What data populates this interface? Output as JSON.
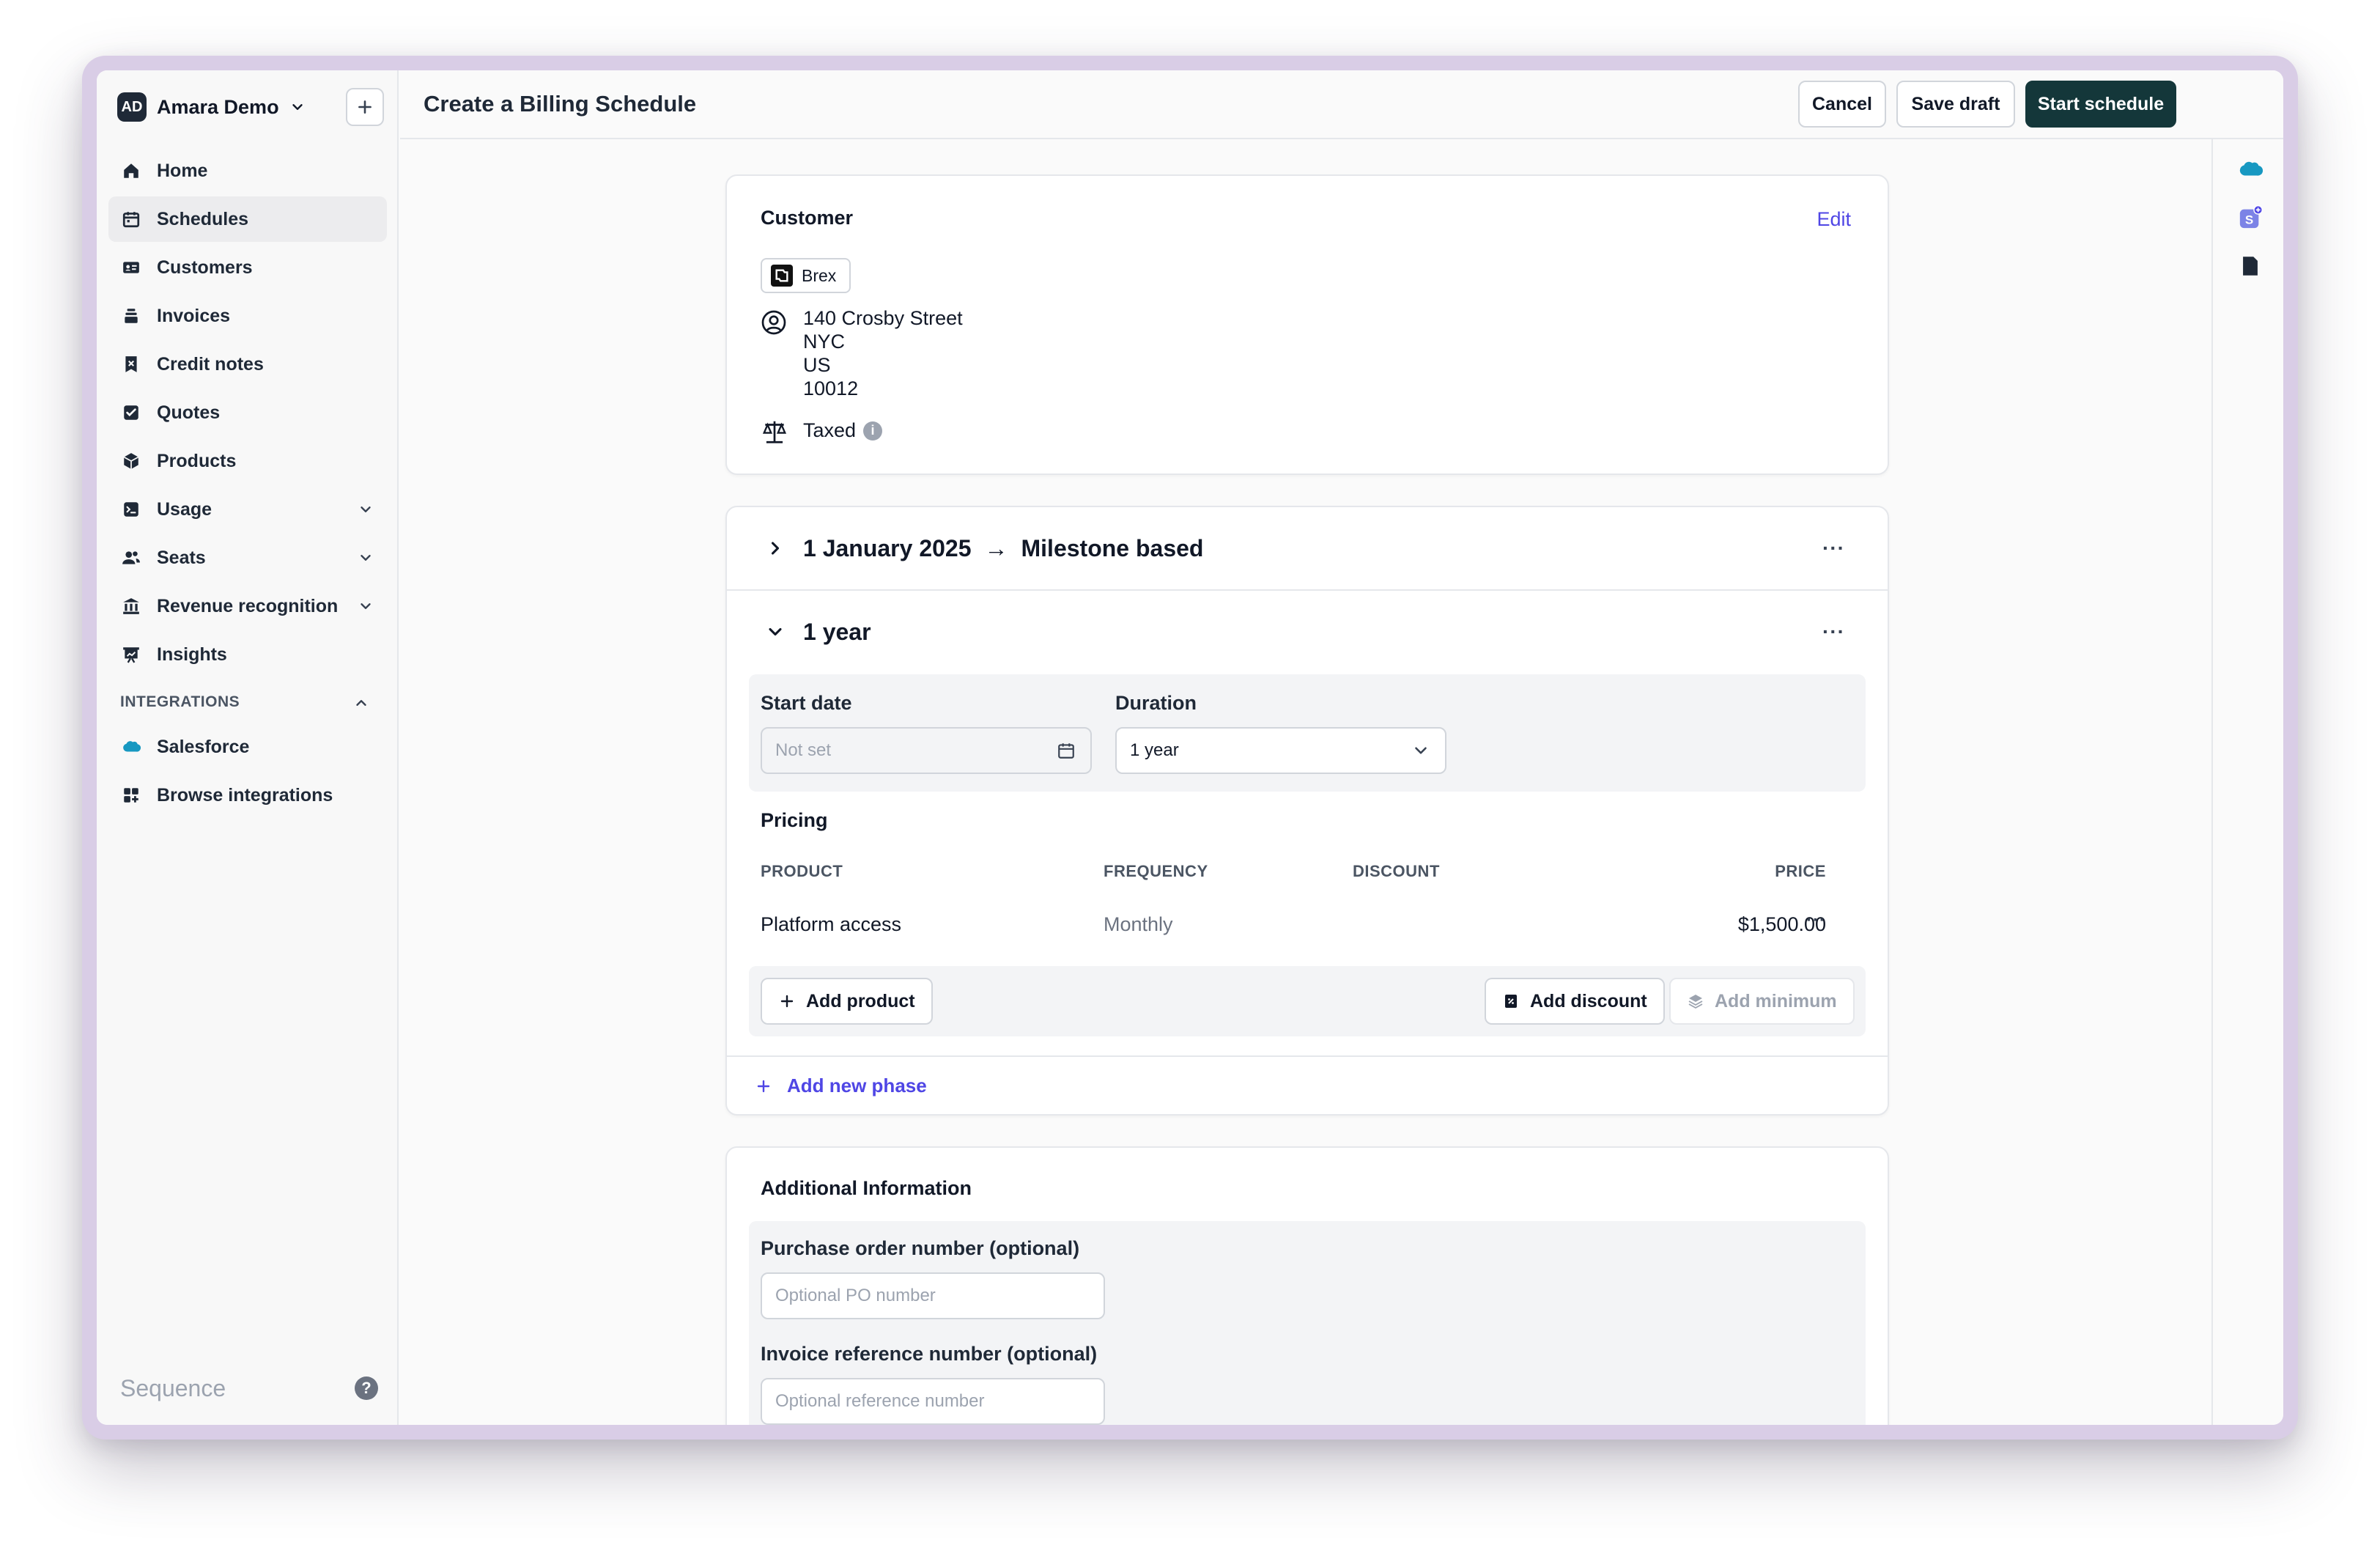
{
  "org": {
    "initials": "AD",
    "name": "Amara Demo"
  },
  "nav": {
    "items": [
      {
        "label": "Home"
      },
      {
        "label": "Schedules"
      },
      {
        "label": "Customers"
      },
      {
        "label": "Invoices"
      },
      {
        "label": "Credit notes"
      },
      {
        "label": "Quotes"
      },
      {
        "label": "Products"
      },
      {
        "label": "Usage"
      },
      {
        "label": "Seats"
      },
      {
        "label": "Revenue recognition"
      },
      {
        "label": "Insights"
      }
    ],
    "active": "Schedules",
    "integrations_label": "INTEGRATIONS",
    "integrations": [
      {
        "label": "Salesforce"
      },
      {
        "label": "Browse integrations"
      }
    ]
  },
  "footer": {
    "brand": "Sequence",
    "help": "?"
  },
  "header": {
    "title": "Create a Billing Schedule",
    "cancel_label": "Cancel",
    "save_draft_label": "Save draft",
    "start_label": "Start schedule"
  },
  "customer": {
    "heading": "Customer",
    "edit_label": "Edit",
    "name": "Brex",
    "address_line1": "140 Crosby Street",
    "address_city": "NYC",
    "address_country": "US",
    "address_zip": "10012",
    "tax_status": "Taxed"
  },
  "phases": {
    "first": {
      "start": "1 January 2025",
      "arrow": "→",
      "end": "Milestone based"
    },
    "second": {
      "title": "1 year",
      "start_date_label": "Start date",
      "start_date_placeholder": "Not set",
      "duration_label": "Duration",
      "duration_value": "1 year"
    },
    "more": "···"
  },
  "pricing": {
    "heading": "Pricing",
    "columns": {
      "product": "PRODUCT",
      "frequency": "FREQUENCY",
      "discount": "DISCOUNT",
      "price": "PRICE"
    },
    "rows": [
      {
        "product": "Platform access",
        "frequency": "Monthly",
        "discount": "",
        "price": "$1,500.00"
      }
    ],
    "add_product_label": "Add product",
    "add_discount_label": "Add discount",
    "add_minimum_label": "Add minimum",
    "add_phase_label": "Add new phase"
  },
  "additional": {
    "heading": "Additional Information",
    "po_label": "Purchase order number (optional)",
    "po_placeholder": "Optional PO number",
    "ref_label": "Invoice reference number (optional)",
    "ref_placeholder": "Optional reference number"
  },
  "colors": {
    "primary": "#14373a",
    "link": "#4f46e5",
    "salesforce": "#1798c1"
  }
}
